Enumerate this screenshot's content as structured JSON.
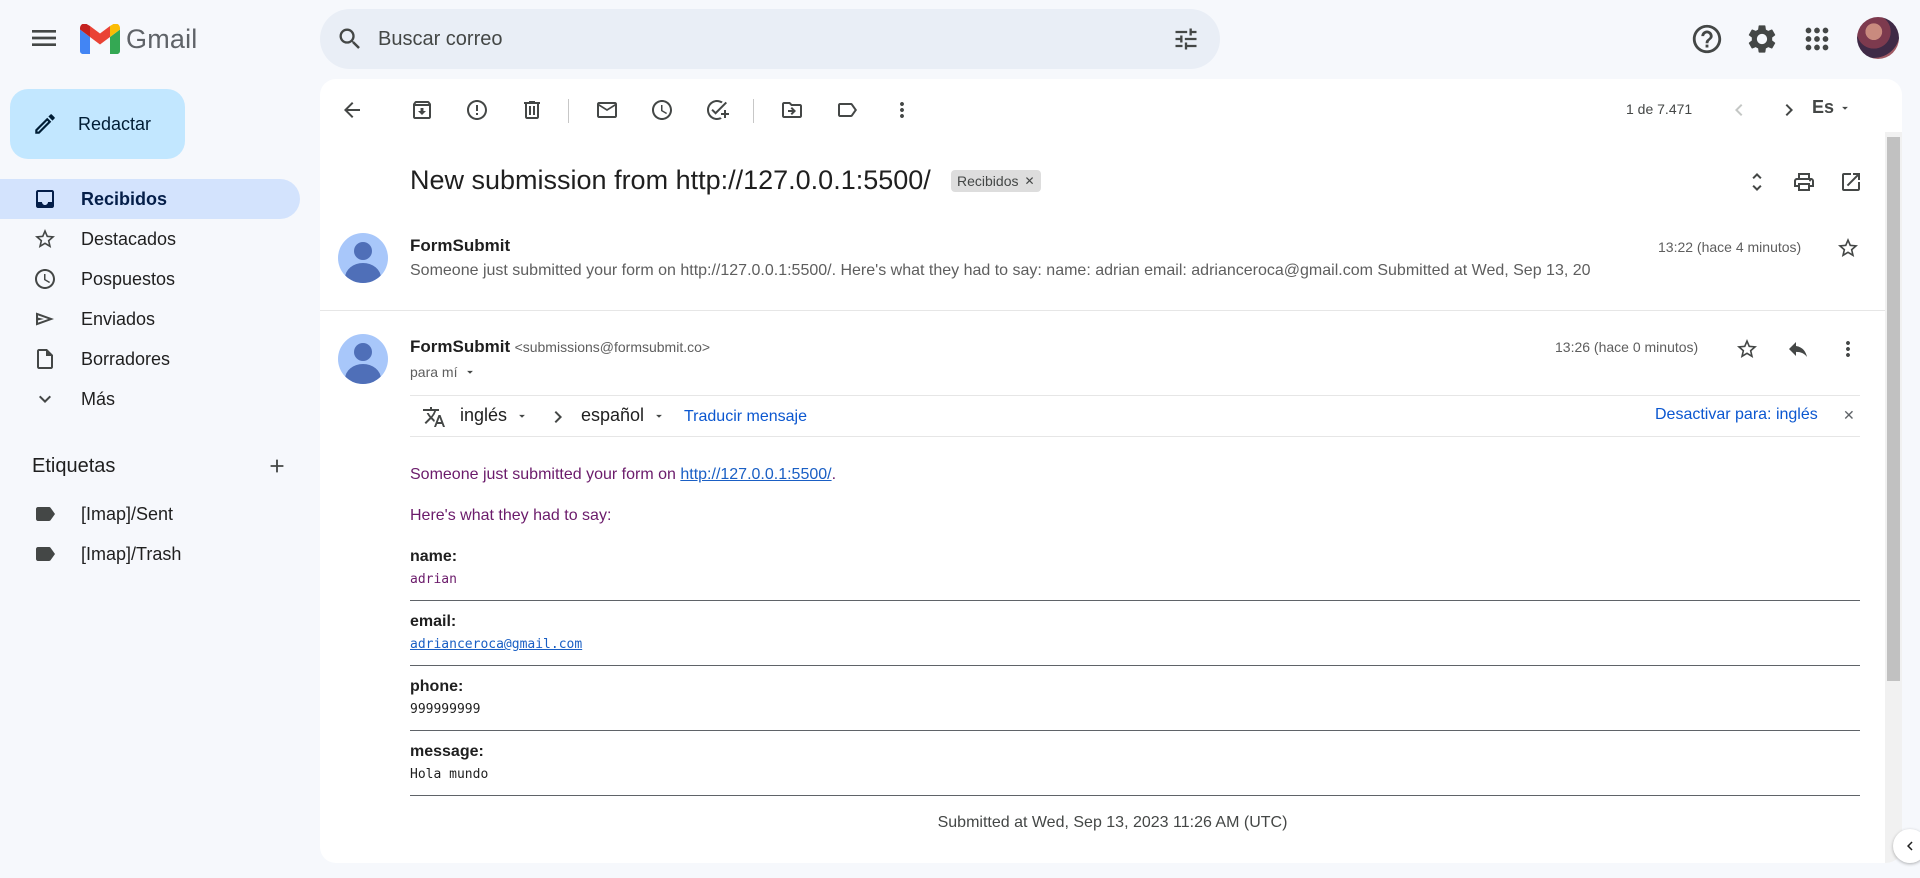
{
  "app": {
    "name": "Gmail",
    "search_placeholder": "Buscar correo"
  },
  "sidebar": {
    "compose_label": "Redactar",
    "items": [
      {
        "label": "Recibidos",
        "icon": "inbox-icon",
        "active": true
      },
      {
        "label": "Destacados",
        "icon": "star-icon",
        "active": false
      },
      {
        "label": "Pospuestos",
        "icon": "clock-icon",
        "active": false
      },
      {
        "label": "Enviados",
        "icon": "send-icon",
        "active": false
      },
      {
        "label": "Borradores",
        "icon": "draft-icon",
        "active": false
      },
      {
        "label": "Más",
        "icon": "chevron-down-icon",
        "active": false
      }
    ],
    "labels_title": "Etiquetas",
    "labels": [
      {
        "label": "[Imap]/Sent",
        "icon": "label-icon"
      },
      {
        "label": "[Imap]/Trash",
        "icon": "label-icon"
      }
    ]
  },
  "toolbar": {
    "count": "1 de 7.471",
    "input_tool": "Es"
  },
  "email": {
    "subject": "New submission from http://127.0.0.1:5500/",
    "label_chip": "Recibidos",
    "collapsed": {
      "sender": "FormSubmit",
      "time": "13:22 (hace 4 minutos)",
      "snippet": "Someone just submitted your form on http://127.0.0.1:5500/. Here's what they had to say: name: adrian email: adrianceroca@gmail.com Submitted at Wed, Sep 13, 20"
    },
    "expanded": {
      "sender": "FormSubmit",
      "email": "<submissions@formsubmit.co>",
      "time": "13:26 (hace 0 minutos)",
      "to": "para mí"
    },
    "translate": {
      "from_lang": "inglés",
      "to_lang": "español",
      "translate_link": "Traducir mensaje",
      "disable_link": "Desactivar para: inglés"
    },
    "body": {
      "intro_text": "Someone just submitted your form on",
      "intro_link": "http://127.0.0.1:5500/",
      "intro_end": ".",
      "say_text": "Here's what they had to say:",
      "fields": [
        {
          "name": "name:",
          "value": "adrian"
        },
        {
          "name": "email:",
          "value": "adrianceroca@gmail.com"
        },
        {
          "name": "phone:",
          "value": "999999999"
        },
        {
          "name": "message:",
          "value": "Hola mundo"
        }
      ],
      "submitted": "Submitted at Wed, Sep 13, 2023 11:26 AM (UTC)"
    }
  },
  "colors": {
    "compose_bg": "#c2e7ff",
    "active_nav_bg": "#d3e3fd",
    "search_bg": "#e9eef6",
    "link": "#0b57d0"
  }
}
